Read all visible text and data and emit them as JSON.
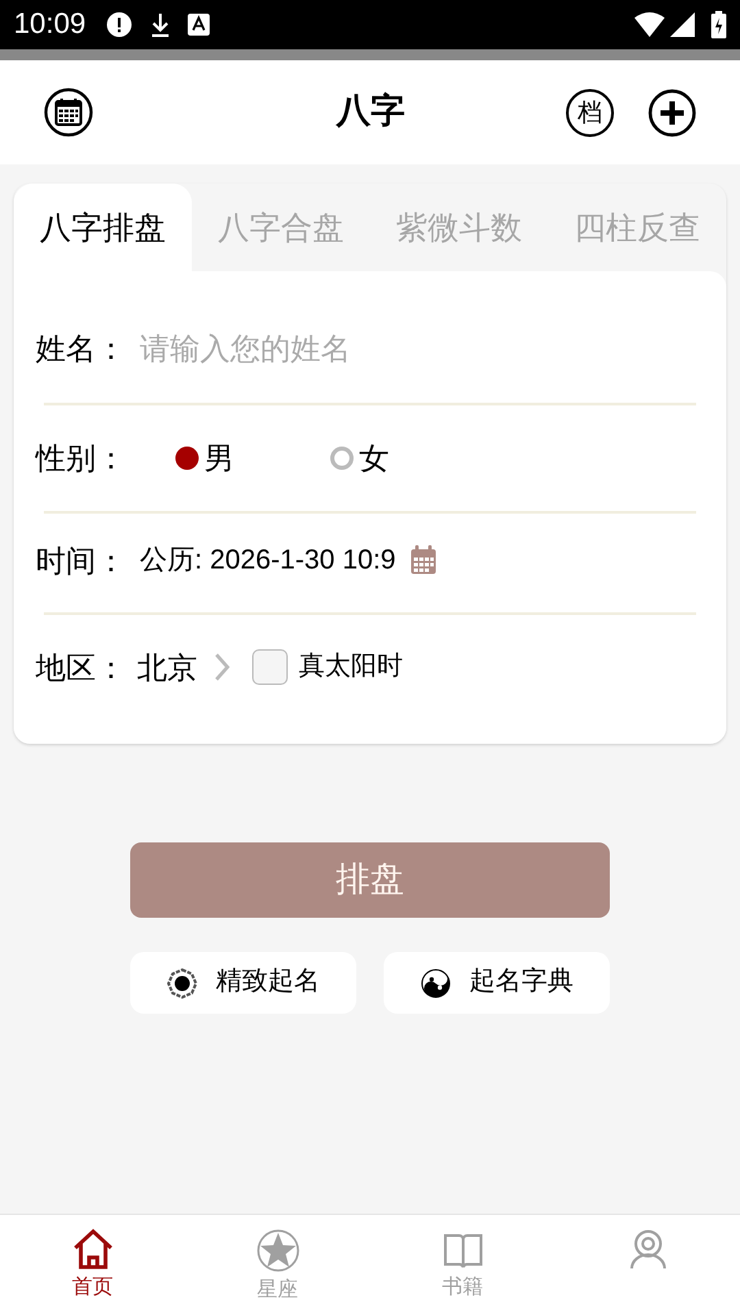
{
  "status_bar": {
    "time": "10:09"
  },
  "header": {
    "title": "八字",
    "archive_button": "档"
  },
  "tabs": [
    {
      "label": "八字排盘",
      "selected": true
    },
    {
      "label": "八字合盘",
      "selected": false
    },
    {
      "label": "紫微斗数",
      "selected": false
    },
    {
      "label": "四柱反查",
      "selected": false
    }
  ],
  "form": {
    "name_label": "姓名：",
    "name_placeholder": "请输入您的姓名",
    "gender_label": "性别：",
    "genders": [
      {
        "label": "男",
        "selected": true
      },
      {
        "label": "女",
        "selected": false
      }
    ],
    "time_label": "时间：",
    "time_value": "公历: 2026-1-30 10:9",
    "region_label": "地区：",
    "region_value": "北京",
    "true_solar_time": {
      "label": "真太阳时",
      "checked": false
    }
  },
  "submit_button": "排盘",
  "quick_buttons": [
    {
      "kind": "bagua",
      "label": "精致起名"
    },
    {
      "kind": "yinyang",
      "label": "起名字典"
    }
  ],
  "bottom_nav": [
    {
      "kind": "home",
      "label": "首页",
      "selected": true
    },
    {
      "kind": "star",
      "label": "星座",
      "selected": false
    },
    {
      "kind": "book",
      "label": "书籍",
      "selected": false
    },
    {
      "kind": "person",
      "selected": false
    }
  ]
}
